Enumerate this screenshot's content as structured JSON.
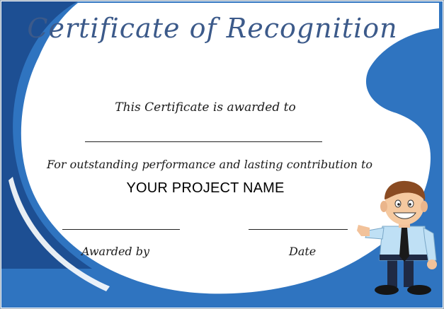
{
  "certificate": {
    "title": "Certificate of Recognition",
    "awarded_to_text": "This Certificate is awarded to",
    "reason_text": "For outstanding performance and lasting contribution to",
    "project_name": "YOUR PROJECT NAME",
    "signature_label": "Awarded by",
    "date_label": "Date"
  },
  "colors": {
    "border_blue": "#2f74c0",
    "border_dark": "#1d4f93",
    "title_text": "#3c5a8a",
    "background": "#ffffff"
  },
  "illustration": {
    "name": "businessman-cartoon",
    "description_icon": "man-pointing-icon"
  }
}
